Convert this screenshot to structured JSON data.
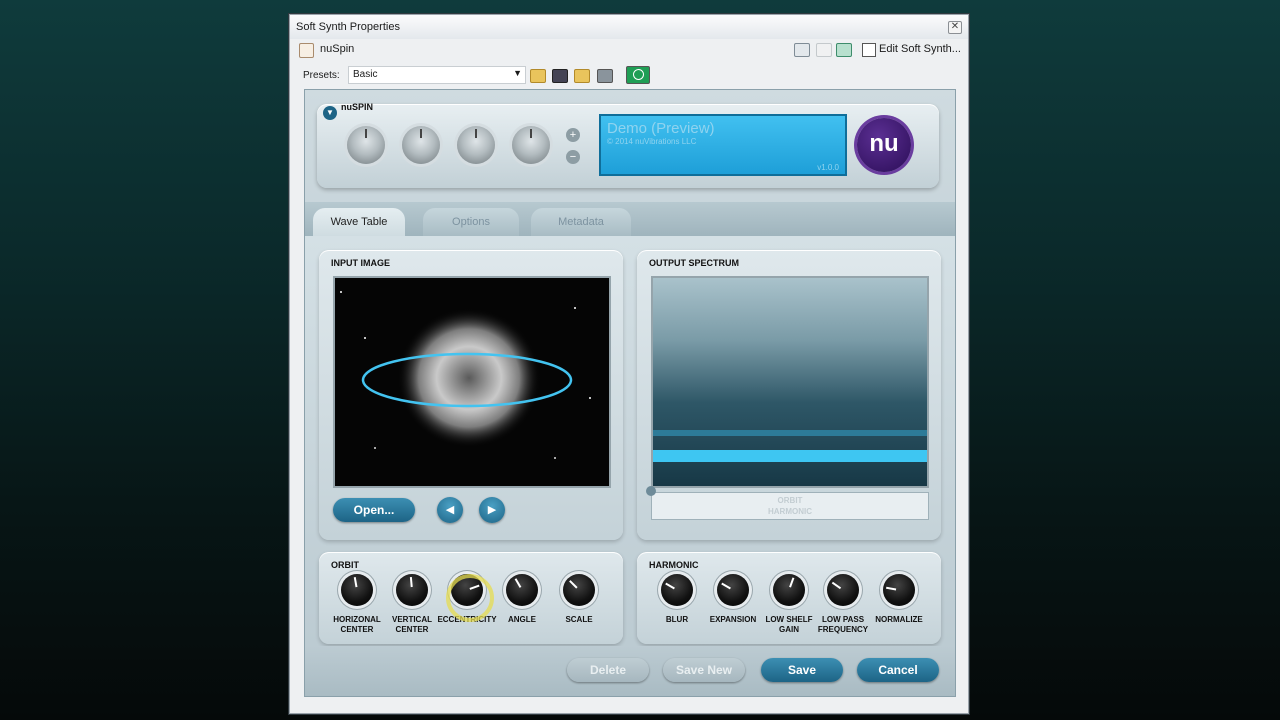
{
  "window": {
    "title": "Soft Synth Properties",
    "close_glyph": "✕"
  },
  "plugin": {
    "name": "nuSpin",
    "edit_label": "Edit Soft Synth..."
  },
  "presets": {
    "label": "Presets:",
    "value": "Basic"
  },
  "module": {
    "name": "nuSPIN",
    "screen_title": "Demo (Preview)",
    "screen_copyright": "© 2014 nuVibrations LLC",
    "screen_version": "v1.0.0",
    "logo_text": "nu",
    "plus": "+",
    "minus": "−"
  },
  "tabs": [
    {
      "label": "Wave Table"
    },
    {
      "label": "Options"
    },
    {
      "label": "Metadata"
    }
  ],
  "input_panel": {
    "title": "INPUT IMAGE",
    "open_label": "Open...",
    "prev_glyph": "◀",
    "next_glyph": "▶"
  },
  "output_panel": {
    "title": "OUTPUT SPECTRUM",
    "slider_label_top": "ORBIT",
    "slider_label_bottom": "HARMONIC"
  },
  "orbit": {
    "title": "ORBIT",
    "knobs": [
      {
        "label1": "HORIZONAL",
        "label2": "CENTER"
      },
      {
        "label1": "VERTICAL",
        "label2": "CENTER"
      },
      {
        "label1": "ECCENTRICITY",
        "label2": ""
      },
      {
        "label1": "ANGLE",
        "label2": ""
      },
      {
        "label1": "SCALE",
        "label2": ""
      }
    ]
  },
  "harmonic": {
    "title": "HARMONIC",
    "knobs": [
      {
        "label1": "BLUR",
        "label2": ""
      },
      {
        "label1": "EXPANSION",
        "label2": ""
      },
      {
        "label1": "LOW SHELF",
        "label2": "GAIN"
      },
      {
        "label1": "LOW PASS",
        "label2": "FREQUENCY"
      },
      {
        "label1": "NORMALIZE",
        "label2": ""
      }
    ]
  },
  "footer": {
    "delete": "Delete",
    "save_new": "Save New",
    "save": "Save",
    "cancel": "Cancel"
  }
}
